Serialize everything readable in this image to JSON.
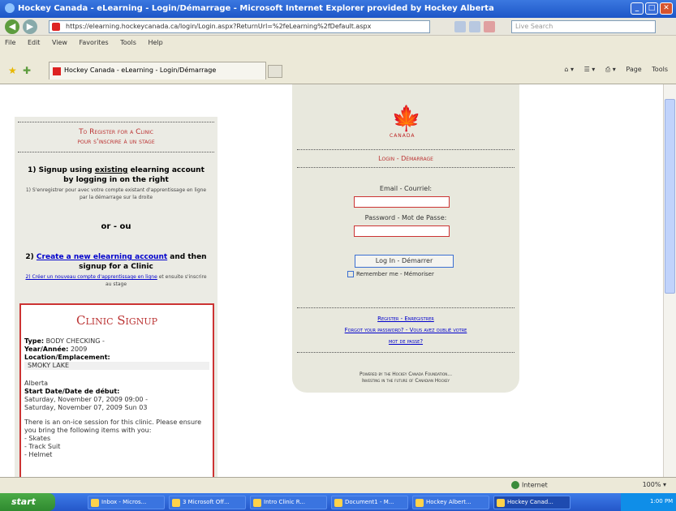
{
  "window": {
    "title": "Hockey Canada - eLearning - Login/Démarrage - Microsoft Internet Explorer provided by Hockey Alberta",
    "url": "https://elearning.hockeycanada.ca/login/Login.aspx?ReturnUrl=%2feLearning%2fDefault.aspx",
    "search_placeholder": "Live Search",
    "tab_title": "Hockey Canada - eLearning - Login/Démarrage"
  },
  "menu": [
    "File",
    "Edit",
    "View",
    "Favorites",
    "Tools",
    "Help"
  ],
  "toolbar_right": [
    "Page",
    "Tools"
  ],
  "left": {
    "header": [
      "To Register for a Clinic",
      "pour s'inscrire à un stage"
    ],
    "step1_prefix": "1) Signup using ",
    "step1_link": "existing",
    "step1_suffix": " elearning account by logging in on the right",
    "step1_sub": "1) S'enregistrer pour avec votre compte existant d'apprentissage en ligne par la démarrage sur la droite",
    "or": "or - ou",
    "step2_prefix": "2) ",
    "step2_link": "Create a new elearning account",
    "step2_suffix": " and then signup for a Clinic",
    "step2_sub_link": "2) Créer un nouveau compte d'apprentissage en ligne",
    "step2_sub": " et ensuite s'inscrire au stage"
  },
  "signup": {
    "title": "Clinic Signup",
    "type_label": "Type:",
    "type_value": "BODY CHECKING -",
    "year_label": "Year/Année:",
    "year_value": "2009",
    "location_label": "Location/Emplacement:",
    "location_value": "SMOKY LAKE",
    "province": "Alberta",
    "date_label": "Start Date/Date de début:",
    "date_line1": "Saturday, November 07, 2009 09:00 -",
    "date_line2": "Saturday, November 07, 2009 Sun 03",
    "note": "There is an on-ice session for this clinic. Please ensure you bring the following items with you:",
    "items": [
      "- Skates",
      "- Track Suit",
      "- Helmet"
    ]
  },
  "login": {
    "logo_text": "CANADA",
    "header": "Login - Démarrage",
    "email_label": "Email - Courriel:",
    "password_label": "Password - Mot de Passe:",
    "button": "Log In - Démarrer",
    "remember": "Remember me - Mémoriser",
    "link_register": "Register - Enregistrer",
    "link_forgot": "Forgot your password? - Vous avez oublié votre",
    "link_forgot2": "mot de passe?",
    "powered1": "Powered by the Hockey Canada Foundation...",
    "powered2": "Investing in the future of Canadian Hockey"
  },
  "status": {
    "zone": "Internet",
    "zoom": "100%"
  },
  "taskbar": {
    "start": "start",
    "tasks": [
      "Inbox - Micros...",
      "3 Microsoft Off...",
      "Intro Clinic R...",
      "Document1 - M...",
      "Hockey Albert...",
      "Hockey Canad..."
    ],
    "time": "1:00 PM"
  },
  "colors": {
    "accent": "#c33333",
    "link": "#0000cc",
    "titlebar": "#2a63d4"
  }
}
